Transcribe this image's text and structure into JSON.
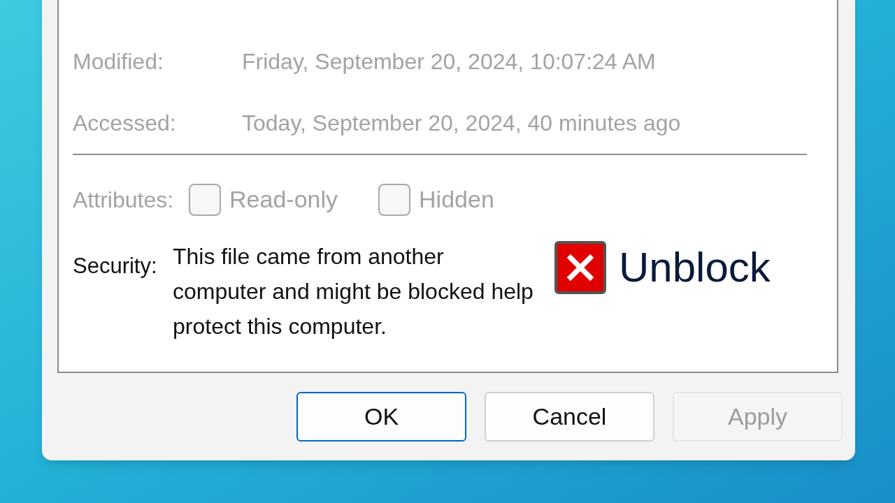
{
  "details": [
    {
      "label": "Modified:",
      "value": "Friday, September 20, 2024, 10:07:24 AM",
      "disabled": true
    },
    {
      "label": "Accessed:",
      "value": "Today, September 20, 2024, 40 minutes ago",
      "disabled": true
    }
  ],
  "attributes": {
    "label": "Attributes:",
    "disabled": true,
    "options": [
      {
        "label": "Read-only",
        "checked": false
      },
      {
        "label": "Hidden",
        "checked": false
      }
    ]
  },
  "security": {
    "label": "Security:",
    "text": "This file came from another computer and might be blocked help protect this computer.",
    "unblock": {
      "label": "Unblock",
      "checked": false
    }
  },
  "buttons": [
    {
      "label": "OK",
      "kind": "default"
    },
    {
      "label": "Cancel",
      "kind": "normal"
    },
    {
      "label": "Apply",
      "kind": "disabled"
    }
  ]
}
